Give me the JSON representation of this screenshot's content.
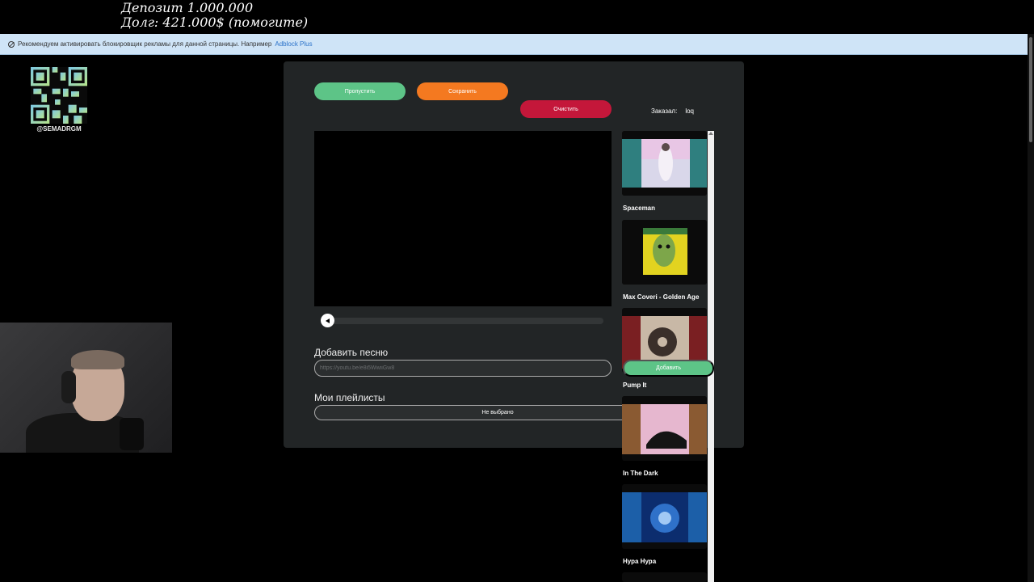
{
  "overlay": {
    "line1": "Депозит 1.000.000",
    "line2": "Долг: 421.000$ (помогите)"
  },
  "adblock": {
    "text": "Рекомендуем активировать блокировщик рекламы для данной страницы. Например",
    "link": "Adblock Plus"
  },
  "qr": {
    "handle": "@SEMADRGM"
  },
  "controls": {
    "skip": "Пропустить",
    "save": "Сохранить",
    "clear": "Очистить"
  },
  "ordered": {
    "label": "Заказал:",
    "value": "loq"
  },
  "add_song": {
    "label": "Добавить песню",
    "placeholder": "https://youtu.be/e8i5WwiiGw8",
    "value": ""
  },
  "playlists": {
    "label": "Мои плейлисты",
    "selected": "Не выбрано"
  },
  "queue": {
    "add_button": "Добавить",
    "items": [
      {
        "title": "Spaceman",
        "accent": "#3a8f8f"
      },
      {
        "title": "Max Coveri - Golden Age",
        "accent": "#e2d320"
      },
      {
        "title": "Pump It",
        "accent": "#7a1f22"
      },
      {
        "title": "In The Dark",
        "accent": "#8a5a32"
      },
      {
        "title": "Нура Нура",
        "accent": "#1c5fa8"
      }
    ]
  }
}
